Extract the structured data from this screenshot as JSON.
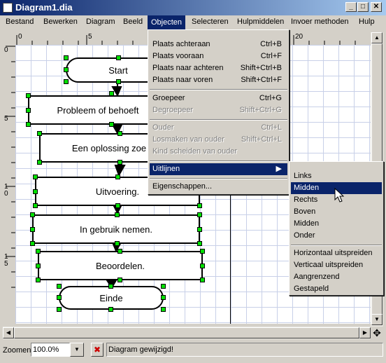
{
  "window": {
    "title": "Diagram1.dia",
    "min_label": "_",
    "max_label": "□",
    "close_label": "✕"
  },
  "menubar": [
    "Bestand",
    "Bewerken",
    "Diagram",
    "Beeld",
    "Objecten",
    "Selecteren",
    "Hulpmiddelen",
    "Invoer methoden",
    "Hulp"
  ],
  "ruler": {
    "h_ticks": [
      "0",
      "5",
      "20"
    ],
    "v_ticks": [
      "0",
      "5",
      "1\n0",
      "1\n5"
    ]
  },
  "objecten_menu": {
    "items": [
      {
        "label": "Plaats achteraan",
        "shortcut": "Ctrl+B",
        "enabled": true
      },
      {
        "label": "Plaats vooraan",
        "shortcut": "Ctrl+F",
        "enabled": true
      },
      {
        "label": "Plaats naar achteren",
        "shortcut": "Shift+Ctrl+B",
        "enabled": true
      },
      {
        "label": "Plaats naar voren",
        "shortcut": "Shift+Ctrl+F",
        "enabled": true
      },
      {
        "label": "Groepeer",
        "shortcut": "Ctrl+G",
        "enabled": true
      },
      {
        "label": "Degroepeer",
        "shortcut": "Shift+Ctrl+G",
        "enabled": false
      },
      {
        "label": "Ouder",
        "shortcut": "Ctrl+L",
        "enabled": false
      },
      {
        "label": "Losmaken van ouder",
        "shortcut": "Shift+Ctrl+L",
        "enabled": false
      },
      {
        "label": "Kind scheiden van ouder",
        "shortcut": "",
        "enabled": false
      },
      {
        "label": "Uitlijnen",
        "shortcut": "▶",
        "enabled": true
      },
      {
        "label": "Eigenschappen...",
        "shortcut": "",
        "enabled": true
      }
    ]
  },
  "uitlijnen_menu": {
    "items": [
      "Links",
      "Midden",
      "Rechts",
      "Boven",
      "Midden",
      "Onder",
      "Horizontaal uitspreiden",
      "Verticaal uitspreiden",
      "Aangrenzend",
      "Gestapeld"
    ]
  },
  "diagram": {
    "nodes": [
      "Start",
      "Probleem of behoeft",
      "Een oplossing zoe",
      "Uitvoering.",
      "In gebruik nemen.",
      "Beoordelen.",
      "Einde"
    ]
  },
  "status": {
    "zoom_label": "Zoomen",
    "zoom_value": "100.0%",
    "message": "Diagram gewijzigd!"
  },
  "colors": {
    "menu_highlight": "#0a246a",
    "handle": "#00e000",
    "title_start": "#0a246a",
    "title_end": "#a6caf0"
  }
}
